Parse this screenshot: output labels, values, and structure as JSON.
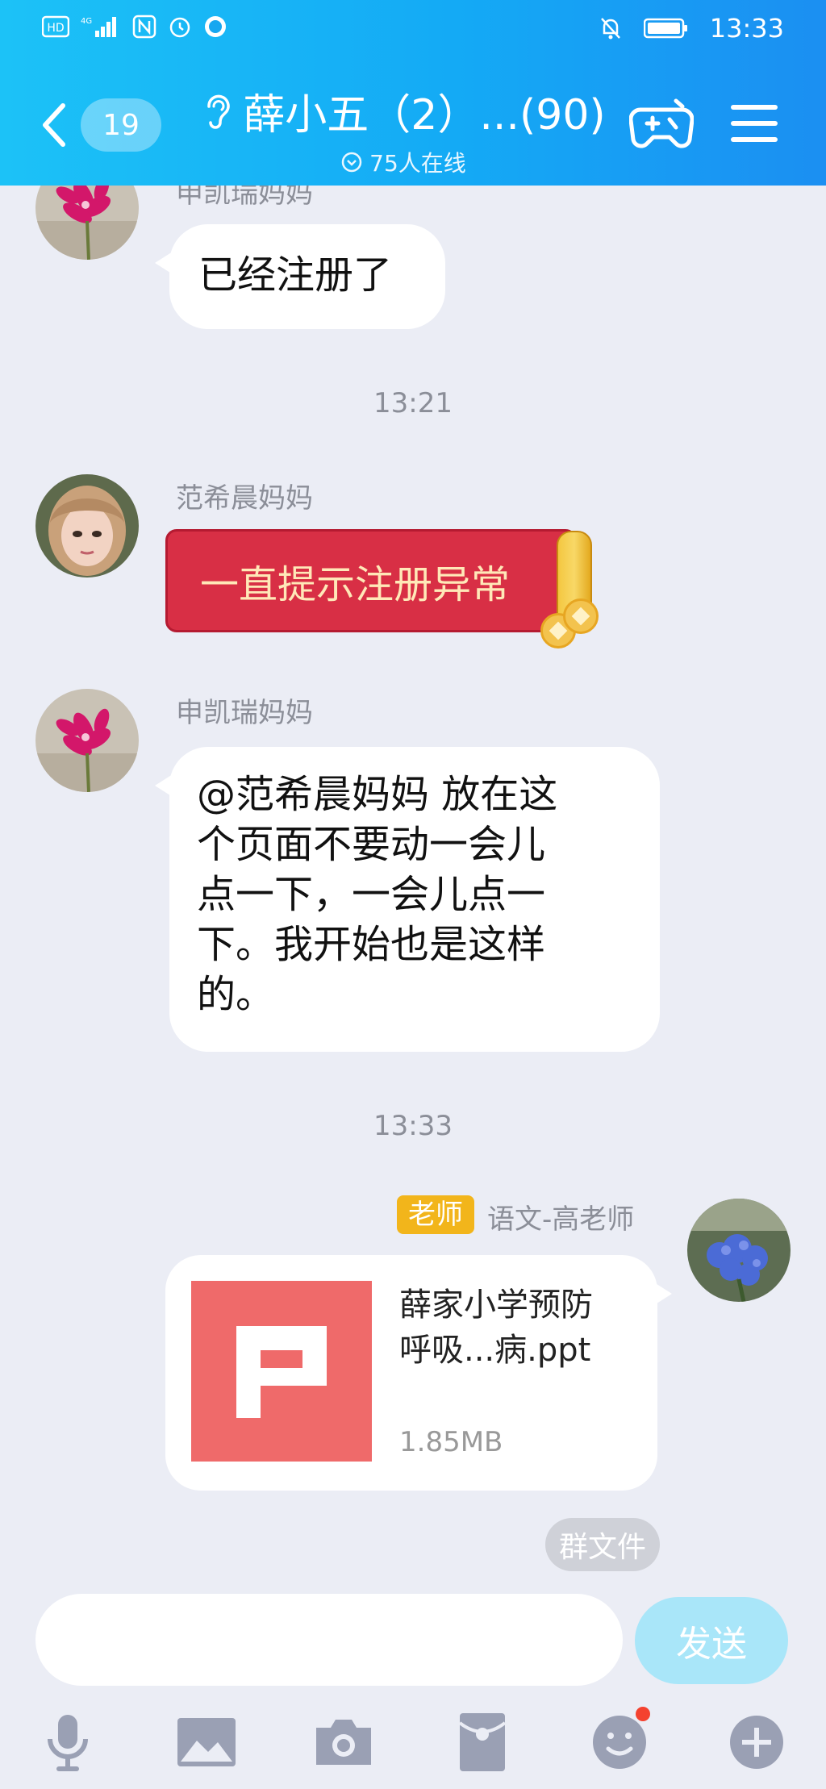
{
  "status_bar": {
    "time": "13:33",
    "network_label": "4G",
    "hd_label": "HD"
  },
  "header": {
    "unread_count": "19",
    "title": "薛小五（2）...(90)",
    "online_count": "75人在线"
  },
  "messages": [
    {
      "sender": "申凯瑞妈妈",
      "text": "已经注册了"
    },
    {
      "timestamp": "13:21"
    },
    {
      "sender": "范希晨妈妈",
      "red_packet_text": "一直提示注册异常"
    },
    {
      "sender": "申凯瑞妈妈",
      "text_lines": [
        "@范希晨妈妈 放在这",
        "个页面不要动一会儿",
        "点一下，一会儿点一",
        "下。我开始也是这样",
        "的。"
      ]
    },
    {
      "timestamp": "13:33"
    },
    {
      "badge": "老师",
      "sender": "语文-高老师",
      "file_name_line1": "薛家小学预防",
      "file_name_line2": "呼吸...病.ppt",
      "file_size": "1.85MB",
      "group_file_label": "群文件"
    }
  ],
  "input": {
    "placeholder": "",
    "send_label": "发送"
  },
  "tools": [
    "microphone-icon",
    "image-icon",
    "camera-icon",
    "red-packet-icon",
    "emoji-icon",
    "plus-icon"
  ],
  "colors": {
    "header_start": "#1cc2f7",
    "header_end": "#1b8ff2",
    "background": "#ebedf5",
    "red_packet": "#d82f45",
    "teacher_badge": "#f2b51b",
    "send_button": "#a9e6f9"
  }
}
